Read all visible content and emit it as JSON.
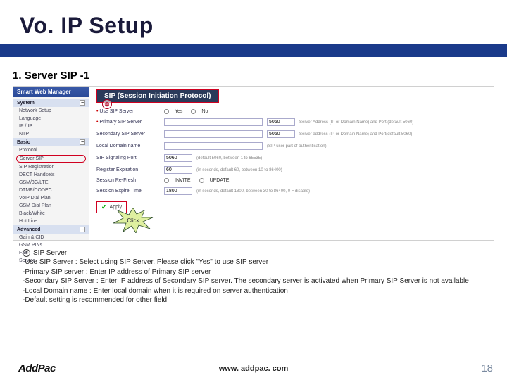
{
  "slide": {
    "title": "Vo. IP Setup",
    "section_number": "1.",
    "section_title": "Server SIP -1"
  },
  "sidebar": {
    "brand": "Smart Web Manager",
    "model": "",
    "sections": {
      "system": "System",
      "basic": "Basic",
      "advanced": "Advanced"
    },
    "system_items": [
      "Network Setup",
      "Language",
      "IP / IP",
      "NTP"
    ],
    "basic_items": [
      "Protocol",
      "Server SIP",
      "SIP Registration",
      "DECT Handsets",
      "GSM/3G/LTE",
      "DTMF/CODEC",
      "VoIP Dial Plan",
      "GSM Dial Plan",
      "Black/White",
      "Hot Line"
    ],
    "advanced_items": [
      "Gain & CID",
      "GSM PINs",
      "Fax",
      "Service"
    ]
  },
  "panel": {
    "title": "SIP (Session Initiation Protocol)",
    "rows": {
      "use_sip": {
        "label": "Use SIP Server",
        "opt_yes": "Yes",
        "opt_no": "No"
      },
      "primary": {
        "label": "Primary SIP Server",
        "port": "5060",
        "hint": "Server Address (IP or Domain Name) and Port (default 5060)"
      },
      "secondary": {
        "label": "Secondary SIP Server",
        "port": "5060",
        "hint": "Server address (IP or Domain Name) and Port(default 5060)"
      },
      "domain": {
        "label": "Local Domain name",
        "hint": "(SIP user part of authentication)"
      },
      "sig_port": {
        "label": "SIP Signaling Port",
        "value": "5060",
        "hint": "(default 5060, between 1 to 65535)"
      },
      "expire": {
        "label": "Register Expiration",
        "value": "60",
        "hint": "(in seconds, default 60, between 10 to 86400)"
      },
      "session": {
        "label": "Session Re-Fresh",
        "opt_on": "INVITE",
        "opt_off": "UPDATE"
      },
      "session_time": {
        "label": "Session Expire Time",
        "value": "1800",
        "hint": "(in seconds, default 1800, between 30 to 86400, 0 = disable)"
      }
    },
    "apply": "Apply"
  },
  "annotations": {
    "marker": "①",
    "click": "Click"
  },
  "notes": {
    "lead_num": "①",
    "lead_text": "SIP Server",
    "lines": [
      "-Use SIP Server : Select using SIP Server. Please click \"Yes\" to use SIP server",
      "-Primary SIP server : Enter IP address of Primary SIP server",
      "-Secondary SIP Server : Enter IP address of Secondary SIP server. The secondary server is activated when Primary SIP Server is not available",
      "-Local Domain name : Enter local domain when it is required on server authentication",
      "-Default setting is recommended for other field"
    ]
  },
  "footer": {
    "logo": "AddPac",
    "url": "www. addpac. com",
    "page": "18"
  }
}
